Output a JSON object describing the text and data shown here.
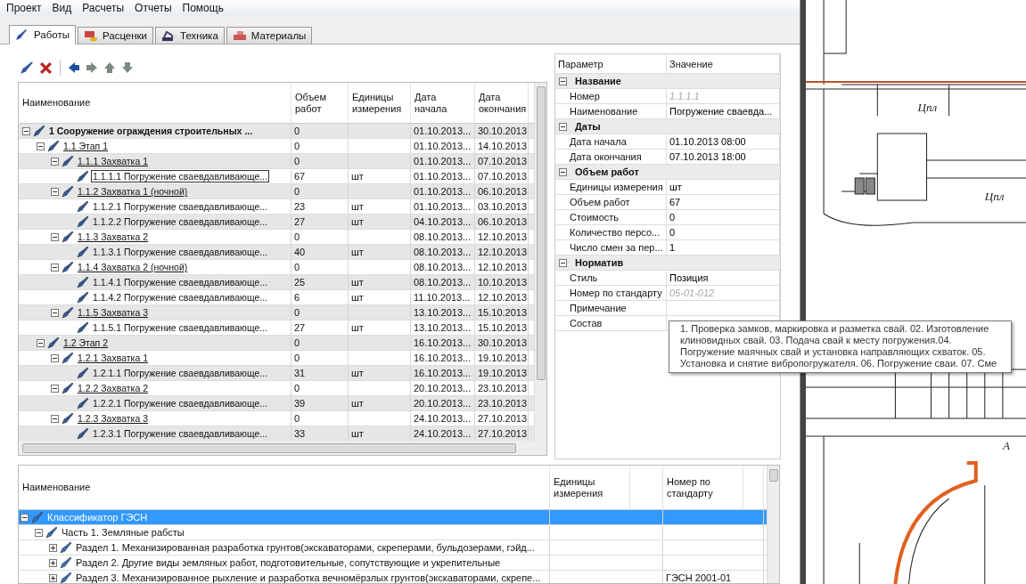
{
  "menu": [
    "Проект",
    "Вид",
    "Расчеты",
    "Отчеты",
    "Помощь"
  ],
  "tabs": [
    {
      "label": "Работы",
      "selected": true
    },
    {
      "label": "Расценки",
      "selected": false
    },
    {
      "label": "Техника",
      "selected": false
    },
    {
      "label": "Материалы",
      "selected": false
    }
  ],
  "works_table": {
    "columns": [
      "Наименование",
      "Объем работ",
      "Единицы измерения",
      "Дата начала",
      "Дата окончания"
    ],
    "rows": [
      {
        "name": "1 Сооружение ограждения строительных ...",
        "volume": "0",
        "start": "01.10.2013...",
        "end": "30.10.2013",
        "expanded": true,
        "selected": false,
        "children": [
          {
            "name": "1.1 Этап 1",
            "volume": "0",
            "start": "01.10.2013...",
            "end": "14.10.2013",
            "expanded": true,
            "selected": false,
            "children": [
              {
                "name": "1.1.1 Захватка 1",
                "volume": "0",
                "start": "01.10.2013...",
                "end": "07.10.2013",
                "expanded": true,
                "selected": false,
                "children": [
                  {
                    "name": "1.1.1.1 Погружение сваевдавливающе...",
                    "volume": "67",
                    "unit": "шт",
                    "start": "01.10.2013...",
                    "end": "07.10.2013",
                    "selected": true
                  }
                ]
              },
              {
                "name": "1.1.2 Захватка 1 (ночной)",
                "volume": "0",
                "start": "01.10.2013...",
                "end": "06.10.2013",
                "expanded": true,
                "selected": false,
                "children": [
                  {
                    "name": "1.1.2.1 Погружение сваевдавливающе...",
                    "volume": "23",
                    "unit": "шт",
                    "start": "01.10.2013...",
                    "end": "03.10.2013",
                    "selected": false
                  },
                  {
                    "name": "1.1.2.2 Погружение сваевдавливающе...",
                    "volume": "27",
                    "unit": "шт",
                    "start": "04.10.2013...",
                    "end": "06.10.2013",
                    "selected": false
                  }
                ]
              },
              {
                "name": "1.1.3 Захватка 2",
                "volume": "0",
                "start": "08.10.2013...",
                "end": "12.10.2013",
                "expanded": true,
                "selected": false,
                "children": [
                  {
                    "name": "1.1.3.1 Погружение сваевдавливающе...",
                    "volume": "40",
                    "unit": "шт",
                    "start": "08.10.2013...",
                    "end": "12.10.2013",
                    "selected": false
                  }
                ]
              },
              {
                "name": "1.1.4 Захватка 2 (ночной)",
                "volume": "0",
                "start": "08.10.2013...",
                "end": "12.10.2013",
                "expanded": true,
                "selected": false,
                "children": [
                  {
                    "name": "1.1.4.1 Погружение сваевдавливающе...",
                    "volume": "25",
                    "unit": "шт",
                    "start": "08.10.2013...",
                    "end": "10.10.2013",
                    "selected": false
                  },
                  {
                    "name": "1.1.4.2 Погружение сваевдавливающе...",
                    "volume": "6",
                    "unit": "шт",
                    "start": "11.10.2013...",
                    "end": "12.10.2013",
                    "selected": false
                  }
                ]
              },
              {
                "name": "1.1.5 Захватка 3",
                "volume": "0",
                "start": "13.10.2013...",
                "end": "15.10.2013",
                "expanded": true,
                "selected": false,
                "children": [
                  {
                    "name": "1.1.5.1 Погружение сваевдавливающе...",
                    "volume": "27",
                    "unit": "шт",
                    "start": "13.10.2013...",
                    "end": "15.10.2013",
                    "selected": false
                  }
                ]
              }
            ]
          },
          {
            "name": "1.2 Этап 2",
            "volume": "0",
            "start": "16.10.2013...",
            "end": "30.10.2013",
            "expanded": true,
            "selected": false,
            "children": [
              {
                "name": "1.2.1 Захватка 1",
                "volume": "0",
                "start": "16.10.2013...",
                "end": "19.10.2013",
                "expanded": true,
                "selected": false,
                "children": [
                  {
                    "name": "1.2.1.1 Погружение сваевдавливающе...",
                    "volume": "31",
                    "unit": "шт",
                    "start": "16.10.2013...",
                    "end": "19.10.2013",
                    "selected": false
                  }
                ]
              },
              {
                "name": "1.2.2 Захватка 2",
                "volume": "0",
                "start": "20.10.2013...",
                "end": "23.10.2013",
                "expanded": true,
                "selected": false,
                "children": [
                  {
                    "name": "1.2.2.1 Погружение сваевдавливающе...",
                    "volume": "39",
                    "unit": "шт",
                    "start": "20.10.2013...",
                    "end": "23.10.2013",
                    "selected": false
                  }
                ]
              },
              {
                "name": "1.2.3 Захватка 3",
                "volume": "0",
                "start": "24.10.2013...",
                "end": "27.10.2013",
                "expanded": true,
                "selected": false,
                "children": [
                  {
                    "name": "1.2.3.1 Погружение сваевдавливающе...",
                    "volume": "33",
                    "unit": "шт",
                    "start": "24.10.2013...",
                    "end": "27.10.2013",
                    "selected": false
                  }
                ]
              }
            ]
          }
        ]
      }
    ]
  },
  "properties": {
    "columns": [
      "Параметр",
      "Значение"
    ],
    "groups": [
      {
        "title": "Название",
        "expanded": true,
        "rows": [
          {
            "name": "Номер",
            "value": "1.1.1.1",
            "readonly": true
          },
          {
            "name": "Наименование",
            "value": "Погружение сваевда...",
            "readonly": false
          }
        ]
      },
      {
        "title": "Даты",
        "expanded": true,
        "rows": [
          {
            "name": "Дата начала",
            "value": "01.10.2013 08:00",
            "readonly": false
          },
          {
            "name": "Дата окончания",
            "value": "07.10.2013 18:00",
            "readonly": false
          }
        ]
      },
      {
        "title": "Объем работ",
        "expanded": true,
        "rows": [
          {
            "name": "Единицы измерения",
            "value": "шт",
            "readonly": false
          },
          {
            "name": "Объем работ",
            "value": "67",
            "readonly": false
          },
          {
            "name": "Стоимость",
            "value": "0",
            "readonly": false
          },
          {
            "name": "Количество персо...",
            "value": "0",
            "readonly": false
          },
          {
            "name": "Число смен за пер...",
            "value": "1",
            "readonly": false
          }
        ]
      },
      {
        "title": "Норматив",
        "expanded": true,
        "rows": [
          {
            "name": "Стиль",
            "value": "Позиция",
            "readonly": false
          },
          {
            "name": "Номер по стандарту",
            "value": "05-01-012",
            "readonly": true
          },
          {
            "name": "Примечание"
          },
          {
            "name": "Состав"
          }
        ]
      }
    ]
  },
  "tooltip": "1. Проверка замков, маркировка и разметка свай. 02. Изготовление клиновидных свай. 03. Подача свай к месту погружения.04. Погружение маячных свай и установка направляющих схваток. 05. Установка и снятие вибропогружателя. 06. Погружение сваи. 07. Сме",
  "classifier": {
    "columns": [
      "Наименование",
      "Единицы измерения",
      "Номер по стандарту"
    ],
    "rows": [
      {
        "name": "Классификатор ГЭСН",
        "expanded": true,
        "selected": true,
        "children": [
          {
            "name": "Часть 1. Земляные рабсты",
            "expanded": true,
            "selected": false,
            "children": [
              {
                "name": "Раздел 1. Механизированная разработка грунтов(экскаваторами, скреперами, бульдозерами, гэйд...",
                "expanded": false,
                "selected": false
              },
              {
                "name": "Раздел 2. Другие виды земляных работ, подготовительные, сопутствующие и укрепительные",
                "expanded": false,
                "selected": false
              },
              {
                "name": "Раздел 3. Механизированное рыхление и разработка вечномёрзлых грунтов(экскаваторами, скрепе...",
                "number": "ГЭСН 2001-01",
                "expanded": false,
                "selected": false
              }
            ]
          }
        ]
      }
    ]
  },
  "drawing_labels": [
    "Цпл",
    "Цпл",
    "А"
  ]
}
